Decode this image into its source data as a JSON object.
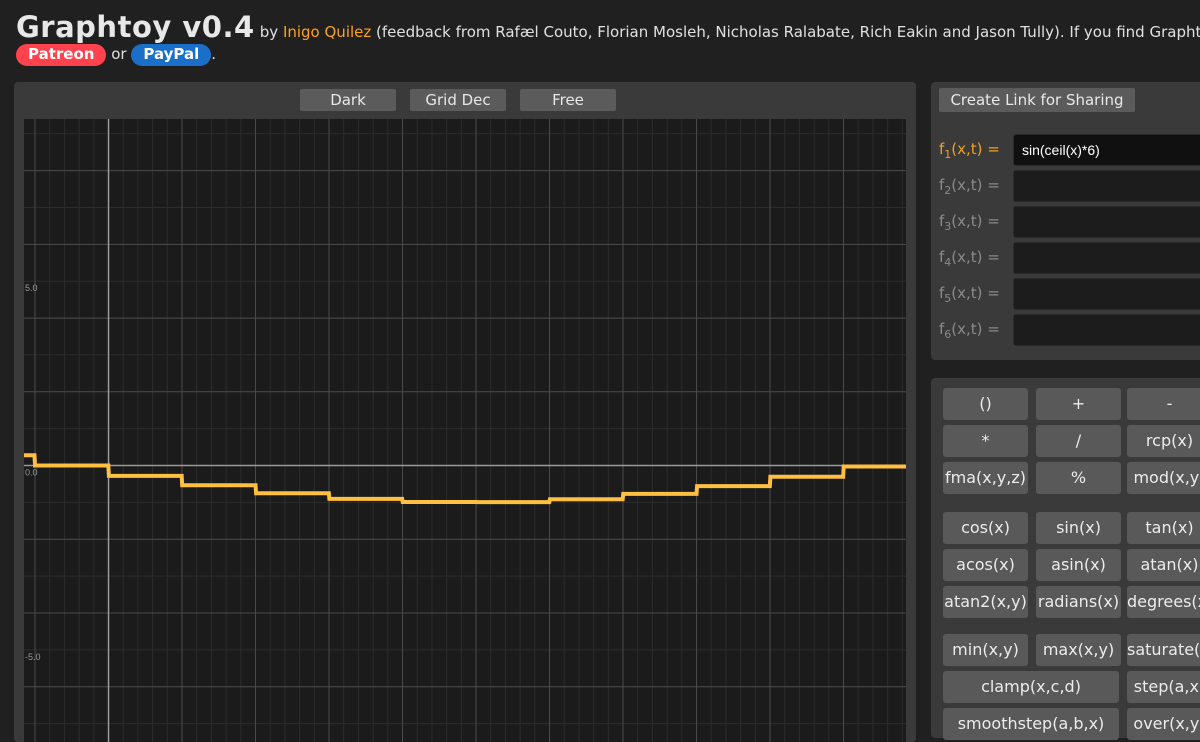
{
  "header": {
    "title": "Graphtoy v0.4",
    "by": "by",
    "author": "Inigo Quilez",
    "credits": "(feedback from Rafæl Couto, Florian Mosleh, Nicholas Ralabate, Rich Eakin and Jason Tully). If you find Graphtoy useful,",
    "patreon": "Patreon",
    "or": "or",
    "paypal": "PayPal",
    "period": "."
  },
  "toolbar": {
    "theme": "Dark",
    "grid": "Grid Dec",
    "mode": "Free"
  },
  "share_button": "Create Link for Sharing",
  "functions": [
    {
      "label": "f",
      "sub": "1",
      "args": "(x,t) =",
      "value": "sin(ceil(x)*6)",
      "active": true
    },
    {
      "label": "f",
      "sub": "2",
      "args": "(x,t) =",
      "value": "",
      "active": false
    },
    {
      "label": "f",
      "sub": "3",
      "args": "(x,t) =",
      "value": "",
      "active": false
    },
    {
      "label": "f",
      "sub": "4",
      "args": "(x,t) =",
      "value": "",
      "active": false
    },
    {
      "label": "f",
      "sub": "5",
      "args": "(x,t) =",
      "value": "",
      "active": false
    },
    {
      "label": "f",
      "sub": "6",
      "args": "(x,t) =",
      "value": "",
      "active": false
    }
  ],
  "buttons": {
    "ops": [
      "()",
      "+",
      "-",
      "*",
      "/",
      "rcp(x)",
      "fma(x,y,z)",
      "%",
      "mod(x,y)"
    ],
    "trig": [
      "cos(x)",
      "sin(x)",
      "tan(x)",
      "acos(x)",
      "asin(x)",
      "atan(x)",
      "atan2(x,y)",
      "radians(x)",
      "degrees(x)"
    ],
    "misc": [
      "min(x,y)",
      "max(x,y)",
      "saturate(x)",
      "clamp(x,c,d)",
      "step(a,x)",
      "smoothstep(a,b,x)",
      "over(x,y)"
    ]
  },
  "chart_data": {
    "type": "line",
    "function": "sin(ceil(x)*6)",
    "ytick_labels": [
      "5.0",
      "0.0",
      "-5.0"
    ],
    "xlim": [
      -1.15,
      10.85
    ],
    "ylim": [
      -7.5,
      9.4
    ],
    "grid": true,
    "color": "#ffbf40",
    "grid_color": "#4a4a4a",
    "axis_color": "#9a9a9a"
  }
}
